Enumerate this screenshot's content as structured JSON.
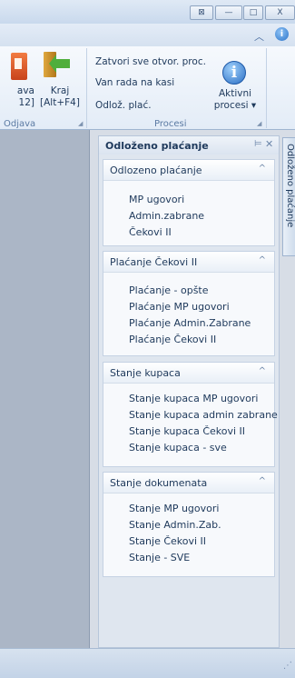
{
  "window": {
    "restore_label": "⊠",
    "minimize_label": "—",
    "maximize_label": "□",
    "close_label": "X"
  },
  "ribbon": {
    "help_label": "i",
    "groups": [
      {
        "name": "Odjava"
      },
      {
        "name": "Procesi"
      }
    ],
    "odjava": {
      "left_btn_line1": "ava",
      "left_btn_line2": "12]",
      "kraj_line1": "Kraj",
      "kraj_line2": "[Alt+F4]"
    },
    "procesi": {
      "close_all": "Zatvori sve otvor. proc.",
      "out_of_work": "Van rada na kasi",
      "deferred_pay": "Odlož. plać.",
      "active_line1": "Aktivni",
      "active_line2": "procesi ▾"
    }
  },
  "panel": {
    "title": "Odloženo plaćanje",
    "side_tab_label": "Odloženo plaćanje",
    "sections": [
      {
        "title": "Odlozeno plaćanje",
        "items": [
          "MP ugovori",
          "Admin.zabrane",
          "Čekovi II"
        ]
      },
      {
        "title": "Plaćanje Čekovi II",
        "items": [
          "Plaćanje - opšte",
          "Plaćanje MP ugovori",
          "Plaćanje Admin.Zabrane",
          "Plaćanje Čekovi II"
        ]
      },
      {
        "title": "Stanje kupaca",
        "items": [
          "Stanje kupaca MP ugovori",
          "Stanje kupaca admin zabrane",
          "Stanje kupaca Čekovi II",
          "Stanje kupaca - sve"
        ]
      },
      {
        "title": "Stanje dokumenata",
        "items": [
          "Stanje MP ugovori",
          "Stanje Admin.Zab.",
          "Stanje Čekovi II",
          "Stanje - SVE"
        ]
      }
    ]
  },
  "icons": {
    "collapse": "chevron-up-icon",
    "help": "info-icon",
    "pin": "pin-icon",
    "close": "close-icon",
    "section_toggle": "chevron-up-icon"
  }
}
